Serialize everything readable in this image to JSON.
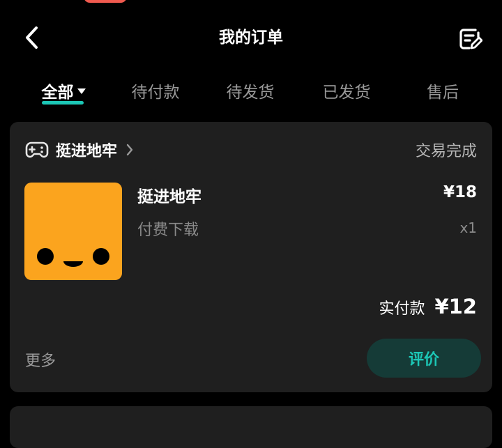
{
  "header": {
    "title": "我的订单",
    "back_icon": "chevron-left-icon",
    "edit_icon": "edit-list-icon"
  },
  "tabs": [
    {
      "label": "全部",
      "active": true,
      "has_dropdown": true
    },
    {
      "label": "待付款",
      "active": false
    },
    {
      "label": "待发货",
      "active": false
    },
    {
      "label": "已发货",
      "active": false
    },
    {
      "label": "售后",
      "active": false
    }
  ],
  "order": {
    "shop_icon": "gamepad-icon",
    "shop_name": "挺进地牢",
    "status": "交易完成",
    "product_name": "挺进地牢",
    "product_type": "付费下载",
    "price": "¥18",
    "quantity": "x1",
    "paid_label": "实付款",
    "paid_amount": "¥12",
    "more_label": "更多",
    "review_label": "评价"
  },
  "colors": {
    "background": "#000000",
    "card": "#1f1f1f",
    "accent": "#1cc7b6",
    "review_button_bg": "#153b37",
    "thumb_bg": "#fba41e"
  }
}
